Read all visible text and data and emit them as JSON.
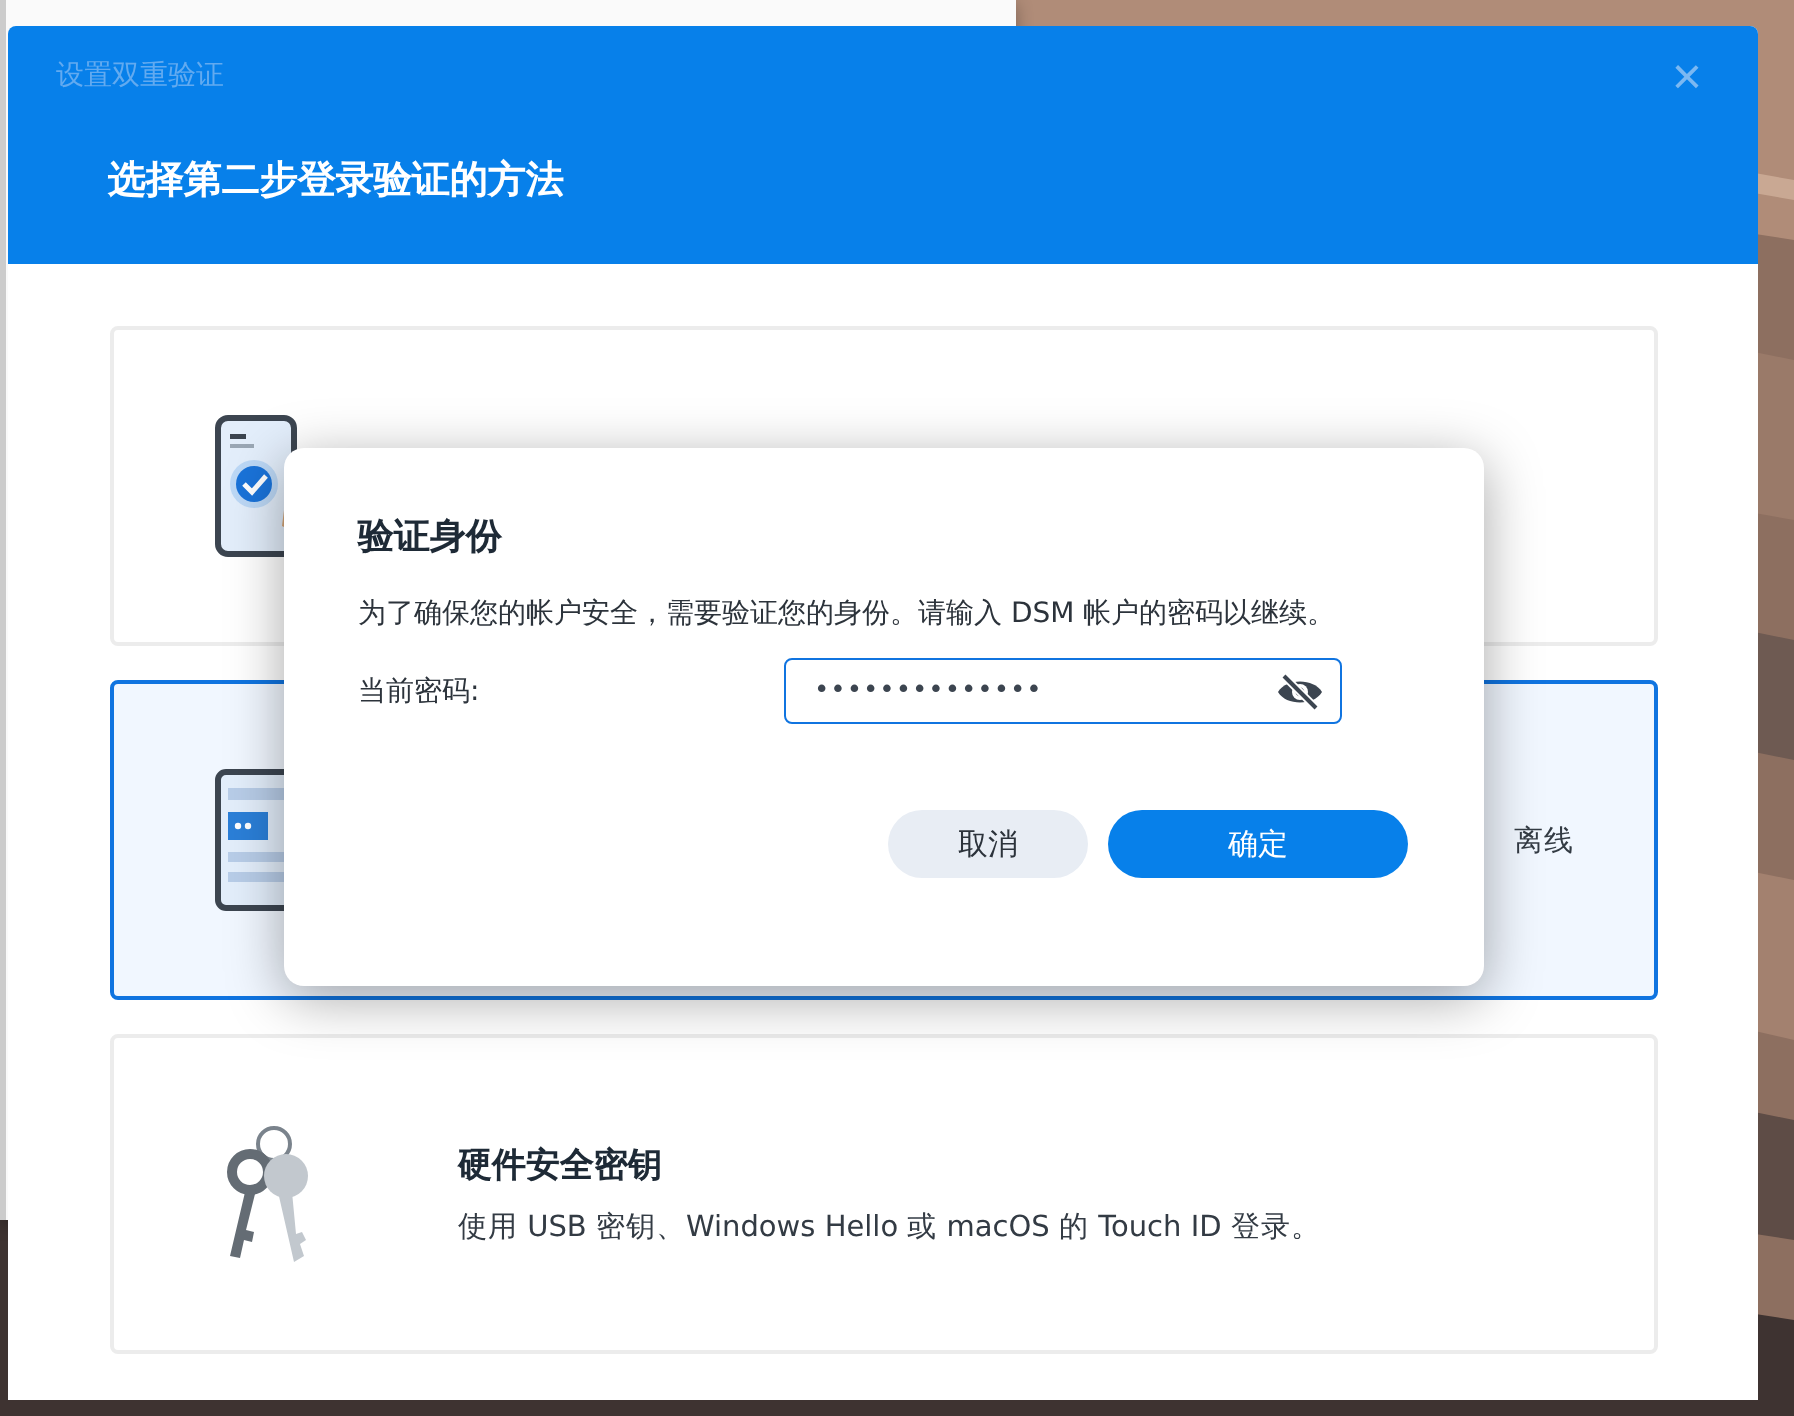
{
  "window": {
    "title": "设置双重验证",
    "close": "×"
  },
  "heading": "选择第二步登录验证的方法",
  "methods": [
    {
      "kind": "phone",
      "selected": false
    },
    {
      "kind": "tablet",
      "selected": true,
      "description": "离线"
    },
    {
      "kind": "keys",
      "selected": false,
      "title": "硬件安全密钥",
      "description": "使用 USB 密钥、Windows Hello 或 macOS 的 Touch ID 登录。"
    }
  ],
  "dialog": {
    "title": "验证身份",
    "message": "为了确保您的帐户安全，需要验证您的身份。请输入 DSM 帐户的密码以继续。",
    "fields": [
      {
        "label": "当前密码:",
        "value": "••••••••••••••"
      }
    ],
    "buttons": [
      {
        "label": "取消",
        "kind": "secondary"
      },
      {
        "label": "确定",
        "kind": "primary"
      }
    ]
  }
}
